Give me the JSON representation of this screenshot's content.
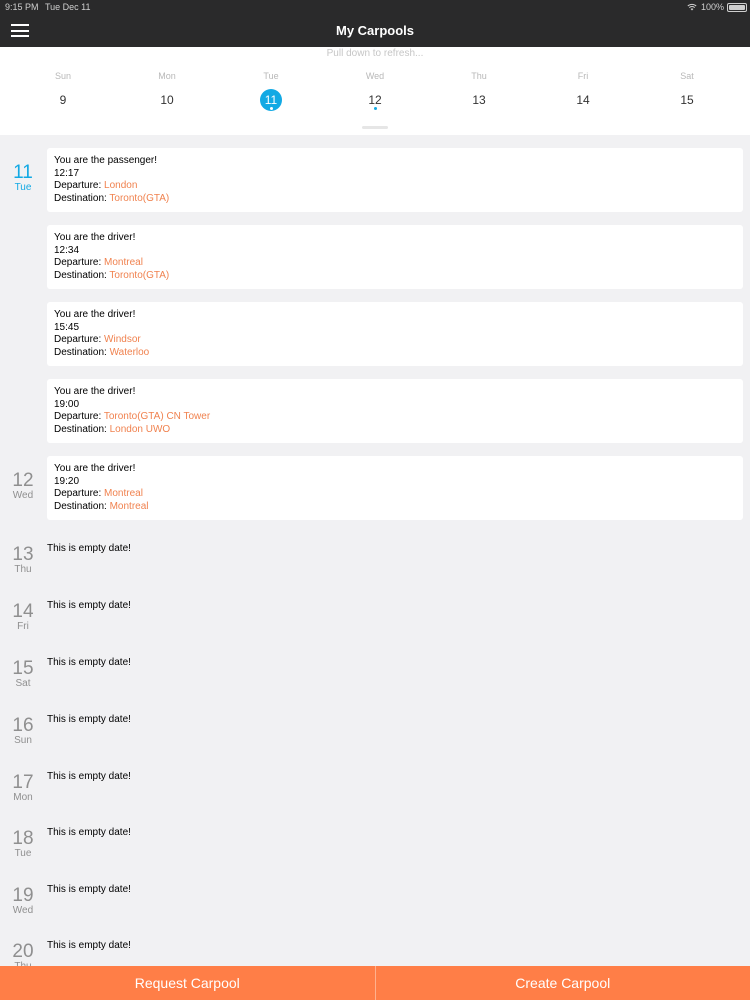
{
  "status_bar": {
    "time": "9:15 PM",
    "date": "Tue Dec 11",
    "battery": "100%",
    "icons": [
      "wifi-icon",
      "battery-icon"
    ]
  },
  "header": {
    "menu_icon": "hamburger-menu-icon",
    "title": "My Carpools"
  },
  "calendar": {
    "pull_hint": "Pull down to refresh...",
    "selected_day": "11",
    "days": [
      {
        "name": "Sun",
        "num": "9"
      },
      {
        "name": "Mon",
        "num": "10"
      },
      {
        "name": "Tue",
        "num": "11"
      },
      {
        "name": "Wed",
        "num": "12"
      },
      {
        "name": "Thu",
        "num": "13"
      },
      {
        "name": "Fri",
        "num": "14"
      },
      {
        "name": "Sat",
        "num": "15"
      }
    ],
    "days_with_events": [
      "11",
      "12"
    ]
  },
  "labels": {
    "departure": "Departure: ",
    "destination": "Destination: "
  },
  "agenda": {
    "empty_text": "This is empty date!",
    "dates": [
      {
        "num": "11",
        "day": "Tue"
      },
      {
        "num": "12",
        "day": "Wed"
      },
      {
        "num": "13",
        "day": "Thu"
      },
      {
        "num": "14",
        "day": "Fri"
      },
      {
        "num": "15",
        "day": "Sat"
      },
      {
        "num": "16",
        "day": "Sun"
      },
      {
        "num": "17",
        "day": "Mon"
      },
      {
        "num": "18",
        "day": "Tue"
      },
      {
        "num": "19",
        "day": "Wed"
      },
      {
        "num": "20",
        "day": "Thu"
      }
    ],
    "items": [
      {
        "role": "You are the passenger!",
        "time": "12:17",
        "departure": "London",
        "destination": "Toronto(GTA)"
      },
      {
        "role": "You are the driver!",
        "time": "12:34",
        "departure": "Montreal",
        "destination": "Toronto(GTA)"
      },
      {
        "role": "You are the driver!",
        "time": "15:45",
        "departure": "Windsor",
        "destination": "Waterloo"
      },
      {
        "role": "You are the driver!",
        "time": "19:00",
        "departure": "Toronto(GTA) CN Tower",
        "destination": "London UWO"
      },
      {
        "role": "You are the driver!",
        "time": "19:20",
        "departure": "Montreal",
        "destination": "Montreal"
      }
    ]
  },
  "bottom_bar": {
    "request_label": "Request Carpool",
    "create_label": "Create Carpool"
  },
  "colors": {
    "accent_blue": "#12a9e4",
    "accent_orange": "#ff7e47",
    "location_orange": "#f0824f",
    "nav_bg": "#2a2a2b"
  }
}
